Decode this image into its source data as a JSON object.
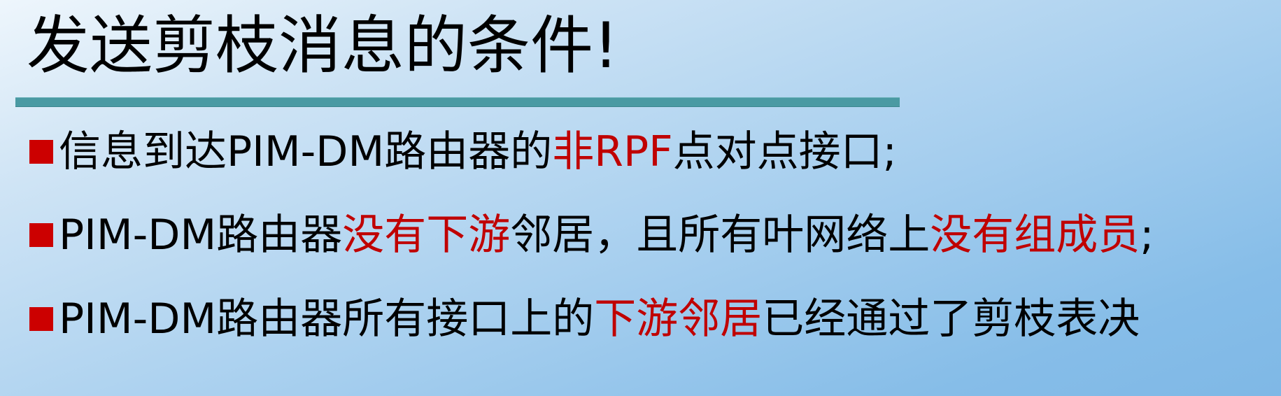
{
  "slide": {
    "title": "发送剪枝消息的条件!",
    "bullets": [
      {
        "segments": [
          {
            "text": "信息到达PIM-DM路由器的",
            "highlight": false
          },
          {
            "text": "非RPF",
            "highlight": true
          },
          {
            "text": "点对点接口;",
            "highlight": false
          }
        ]
      },
      {
        "segments": [
          {
            "text": "PIM-DM路由器",
            "highlight": false
          },
          {
            "text": "没有下游",
            "highlight": true
          },
          {
            "text": "邻居，且所有叶网络上",
            "highlight": false
          },
          {
            "text": "没有组成员",
            "highlight": true
          },
          {
            "text": ";",
            "highlight": false
          }
        ]
      },
      {
        "segments": [
          {
            "text": "PIM-DM路由器所有接口上的",
            "highlight": false
          },
          {
            "text": "下游邻居",
            "highlight": true
          },
          {
            "text": "已经通过了剪枝表决",
            "highlight": false
          }
        ]
      }
    ]
  },
  "colors": {
    "title_rule": "#4a9aa3",
    "bullet_marker": "#cc0000",
    "highlight_text": "#c00000",
    "normal_text": "#000000"
  },
  "icons": {
    "bullet_marker": "square-bullet-icon"
  }
}
